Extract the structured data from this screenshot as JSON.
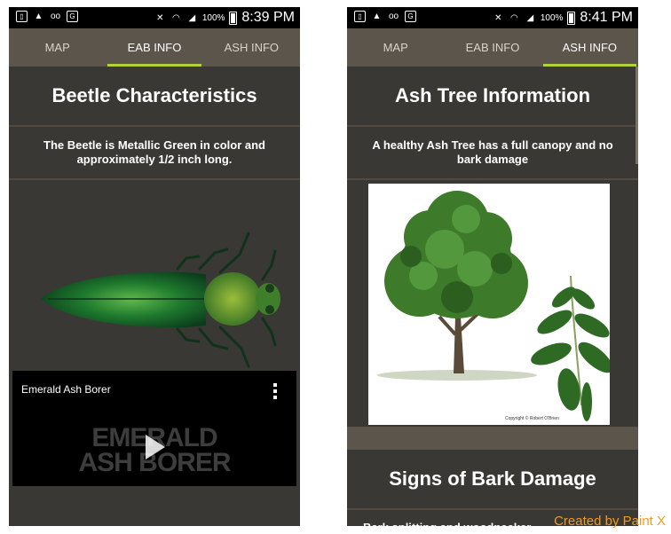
{
  "left_screen": {
    "status_bar": {
      "battery": "100%",
      "time": "8:39 PM"
    },
    "tabs": [
      {
        "label": "MAP"
      },
      {
        "label": "EAB INFO"
      },
      {
        "label": "ASH INFO"
      }
    ],
    "active_tab": "EAB INFO",
    "title": "Beetle Characteristics",
    "description": "The Beetle is Metallic Green in color and approximately 1/2 inch long.",
    "video": {
      "title": "Emerald Ash Borer",
      "logo_line1": "EMERALD",
      "logo_line2": "ASH BORER"
    }
  },
  "right_screen": {
    "status_bar": {
      "battery": "100%",
      "time": "8:41 PM"
    },
    "tabs": [
      {
        "label": "MAP"
      },
      {
        "label": "EAB INFO"
      },
      {
        "label": "ASH INFO"
      }
    ],
    "active_tab": "ASH INFO",
    "title": "Ash Tree Information",
    "description": "A healthy Ash Tree has a full canopy and no bark damage",
    "image_credit": "Copyright © Robert O'Brien",
    "section2_title": "Signs of Bark Damage",
    "section2_description": "Bark splitting and woodpecker"
  },
  "watermark": "Created by Paint X",
  "colors": {
    "background": "#3a3835",
    "tab_bar": "#5c554b",
    "active_tab_indicator": "#b3d334"
  }
}
